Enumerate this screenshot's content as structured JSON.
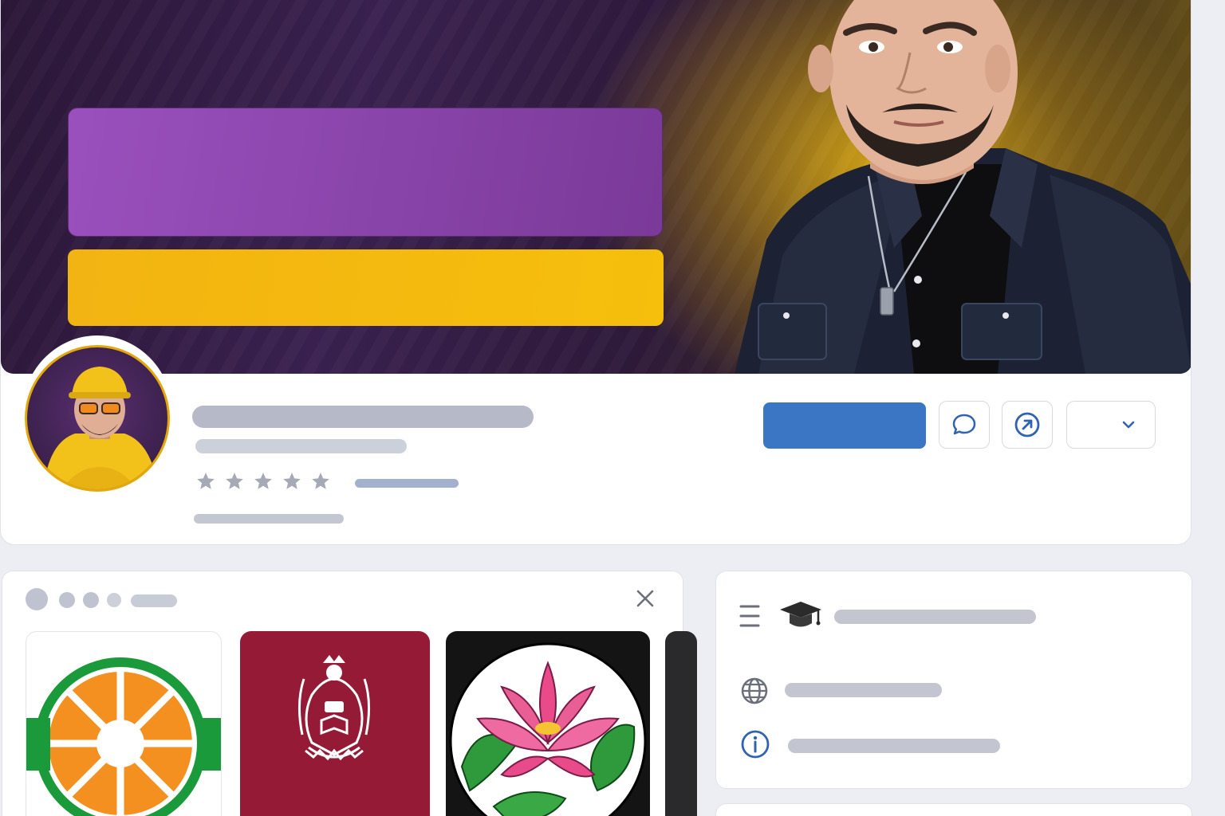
{
  "profile": {
    "cover": {
      "portrait": "cover-portrait",
      "accent_purple": "#8d46af",
      "accent_yellow": "#f4b90f"
    },
    "avatar": "avatar",
    "rating_stars": 5,
    "actions": {
      "primary_color": "#3a76c4",
      "message_icon": "chat-bubble-icon",
      "share_icon": "arrow-up-right-circle-icon",
      "more_icon": "chevron-down-icon"
    }
  },
  "gallery": {
    "close_icon": "close-icon",
    "tiles": [
      {
        "icon": "orange-wheel-logo",
        "color": "#f39020"
      },
      {
        "icon": "crest-emblem",
        "color": "#951a35"
      },
      {
        "icon": "lotus-flower",
        "color": "#e84a8a"
      }
    ]
  },
  "info": {
    "rows": [
      {
        "icons": [
          "menu-icon",
          "graduation-cap-icon"
        ]
      },
      {
        "icons": [
          "globe-icon"
        ]
      },
      {
        "icons": [
          "info-icon"
        ]
      }
    ],
    "icon_color": "#2f62b0"
  }
}
